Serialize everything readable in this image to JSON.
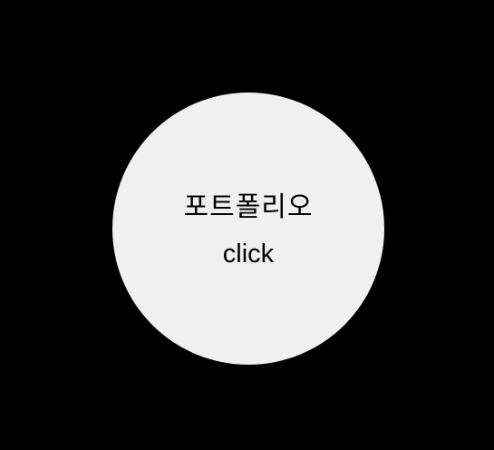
{
  "portfolio": {
    "title": "포트폴리오",
    "action": "click"
  },
  "colors": {
    "background": "#000000",
    "circle": "#f0f0f0",
    "text": "#000000"
  }
}
